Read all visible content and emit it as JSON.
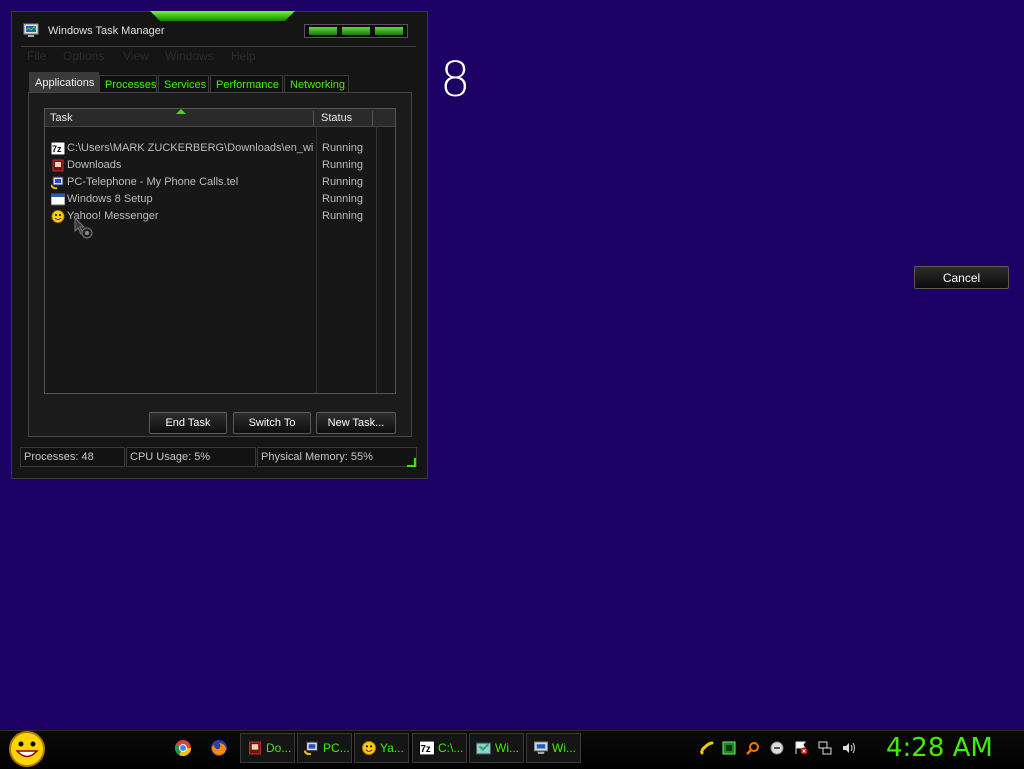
{
  "desktop": {
    "background": "#1c0063",
    "big_label": "8",
    "cancel_label": "Cancel"
  },
  "window": {
    "title": "Windows Task Manager",
    "menu": [
      "File",
      "Options",
      "View",
      "Windows",
      "Help"
    ],
    "tabs": [
      "Applications",
      "Processes",
      "Services",
      "Performance",
      "Networking"
    ],
    "active_tab": "Applications",
    "columns": [
      "Task",
      "Status"
    ],
    "rows": [
      {
        "task": "C:\\Users\\MARK ZUCKERBERG\\Downloads\\en_wi...",
        "status": "Running",
        "icon": "7zip-icon"
      },
      {
        "task": "Downloads",
        "status": "Running",
        "icon": "downloads-icon"
      },
      {
        "task": "PC-Telephone - My Phone Calls.tel",
        "status": "Running",
        "icon": "pc-telephone-icon"
      },
      {
        "task": "Windows 8 Setup",
        "status": "Running",
        "icon": "setup-window-icon"
      },
      {
        "task": "Yahoo! Messenger",
        "status": "Running",
        "icon": "yahoo-messenger-icon"
      }
    ],
    "buttons": {
      "end_task": "End Task",
      "switch_to": "Switch To",
      "new_task": "New Task..."
    },
    "status": {
      "processes": "Processes: 48",
      "cpu": "CPU Usage: 5%",
      "memory": "Physical Memory: 55%"
    },
    "accent": "#3ee000"
  },
  "taskbar": {
    "items": [
      {
        "label": "Do...",
        "icon": "downloads-icon"
      },
      {
        "label": "PC...",
        "icon": "pc-telephone-icon"
      },
      {
        "label": "Ya...",
        "icon": "yahoo-messenger-icon"
      },
      {
        "label": "C:\\...",
        "icon": "7zip-icon"
      },
      {
        "label": "Wi...",
        "icon": "setup-window-icon"
      },
      {
        "label": "Wi...",
        "icon": "task-manager-icon"
      }
    ],
    "clock": "4:28 AM",
    "clock_color": "#3ef000"
  }
}
